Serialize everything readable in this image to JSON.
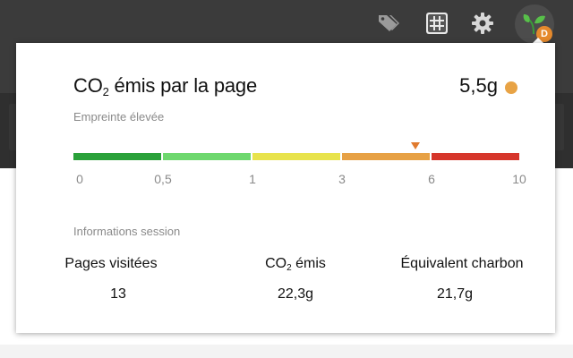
{
  "toolbar": {
    "icons": [
      "tag-icon",
      "grid-icon",
      "gear-icon",
      "leaf-extension-icon"
    ],
    "extension_badge": "D"
  },
  "popup": {
    "title": {
      "main": "CO",
      "sub": "2",
      "rest": " émis par la page"
    },
    "value": "5,5g",
    "value_dot_color": "#e8a345",
    "footprint_label": "Empreinte élevée",
    "scale": {
      "segments": [
        {
          "from": 0,
          "to": 0.5,
          "color": "#2aa13a"
        },
        {
          "from": 0.5,
          "to": 1,
          "color": "#6ed86e"
        },
        {
          "from": 1,
          "to": 3,
          "color": "#e8e34c"
        },
        {
          "from": 3,
          "to": 6,
          "color": "#e7a145"
        },
        {
          "from": 6,
          "to": 10,
          "color": "#d6362b"
        }
      ],
      "ticks": [
        "0",
        "0,5",
        "1",
        "3",
        "6",
        "10"
      ],
      "marker_value": 5.5
    },
    "session_label": "Informations session",
    "stats": [
      {
        "label": "Pages visitées",
        "value": "13"
      },
      {
        "label_main": "CO",
        "label_sub": "2",
        "label_rest": " émis",
        "value": "22,3g"
      },
      {
        "label": "Équivalent charbon",
        "value": "21,7g"
      }
    ]
  }
}
